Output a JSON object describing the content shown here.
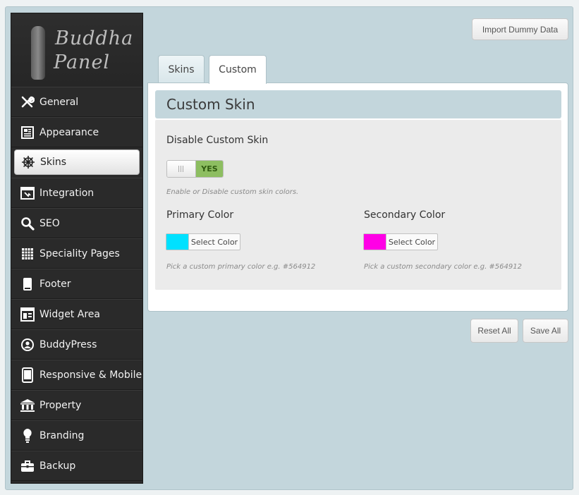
{
  "header": {
    "import_button": "Import Dummy Data"
  },
  "logo": {
    "line1": "Buddha",
    "line2": "Panel"
  },
  "sidebar": {
    "items": [
      {
        "label": "General",
        "icon": "wrench-icon"
      },
      {
        "label": "Appearance",
        "icon": "appearance-icon"
      },
      {
        "label": "Skins",
        "icon": "ship-wheel-icon",
        "active": true
      },
      {
        "label": "Integration",
        "icon": "integration-icon"
      },
      {
        "label": "SEO",
        "icon": "search-icon"
      },
      {
        "label": "Speciality Pages",
        "icon": "grid-icon"
      },
      {
        "label": "Footer",
        "icon": "footer-icon"
      },
      {
        "label": "Widget Area",
        "icon": "widget-icon"
      },
      {
        "label": "BuddyPress",
        "icon": "buddypress-icon"
      },
      {
        "label": "Responsive & Mobile",
        "icon": "mobile-icon"
      },
      {
        "label": "Property",
        "icon": "bank-icon"
      },
      {
        "label": "Branding",
        "icon": "lightbulb-icon"
      },
      {
        "label": "Backup",
        "icon": "briefcase-icon"
      }
    ]
  },
  "tabs": [
    {
      "label": "Skins",
      "active": false
    },
    {
      "label": "Custom",
      "active": true
    }
  ],
  "panel": {
    "title": "Custom Skin",
    "disable_label": "Disable Custom Skin",
    "toggle_value": "YES",
    "toggle_hint": "Enable or Disable custom skin colors.",
    "primary": {
      "label": "Primary Color",
      "button": "Select Color",
      "color": "#00e1ff",
      "hint": "Pick a custom primary color e.g. #564912"
    },
    "secondary": {
      "label": "Secondary Color",
      "button": "Select Color",
      "color": "#ff00e6",
      "hint": "Pick a custom secondary color e.g. #564912"
    }
  },
  "footer": {
    "reset": "Reset All",
    "save": "Save All"
  }
}
